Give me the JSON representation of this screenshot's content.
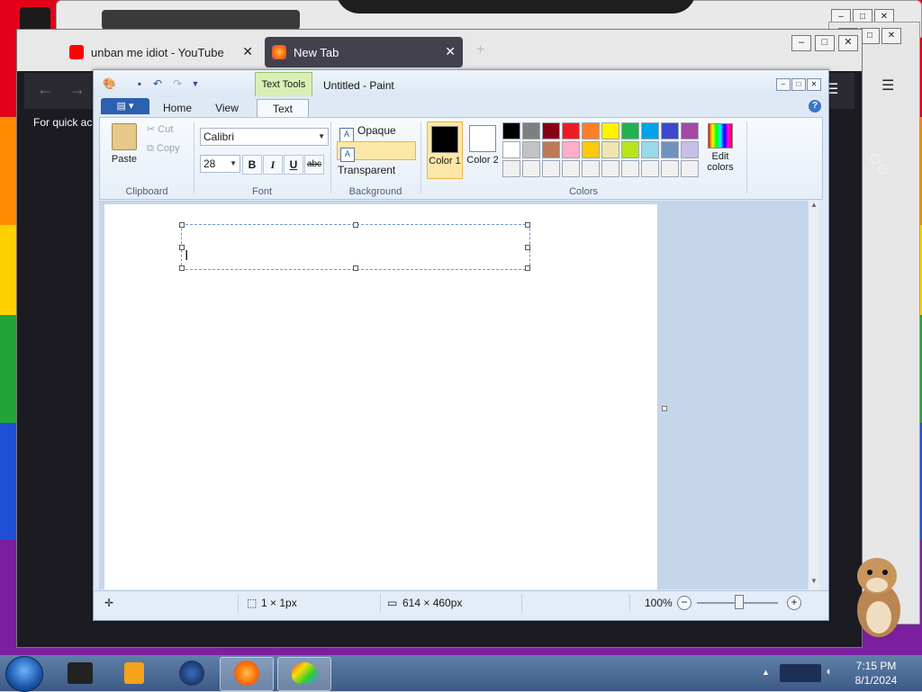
{
  "firefox": {
    "tabs": [
      {
        "title": "unban me idiot - YouTube",
        "active": false
      },
      {
        "title": "New Tab",
        "active": true
      }
    ],
    "new_tab_symbol": "+",
    "quick_access_text": "For quick ac"
  },
  "paint": {
    "title": "Untitled - Paint",
    "context_tab": "Text Tools",
    "tabs": [
      "Home",
      "View",
      "Text"
    ],
    "clipboard": {
      "paste": "Paste",
      "cut": "Cut",
      "copy": "Copy",
      "group": "Clipboard"
    },
    "font": {
      "name": "Calibri",
      "size": "28",
      "bold": "B",
      "italic": "I",
      "underline": "U",
      "strike": "abc",
      "group": "Font"
    },
    "background": {
      "opaque": "Opaque",
      "transparent": "Transparent",
      "group": "Background",
      "selected": "transparent"
    },
    "colors": {
      "color1_label": "Color 1",
      "color2_label": "Color 2",
      "color1": "#000000",
      "color2": "#ffffff",
      "edit_label": "Edit colors",
      "group": "Colors",
      "palette": [
        "#000000",
        "#7f7f7f",
        "#880015",
        "#ed1c24",
        "#ff7f27",
        "#fff200",
        "#22b14c",
        "#00a2e8",
        "#3f48cc",
        "#a349a4",
        "#ffffff",
        "#c3c3c3",
        "#b97a57",
        "#ffaec9",
        "#ffc90e",
        "#efe4b0",
        "#b5e61d",
        "#99d9ea",
        "#7092be",
        "#c8bfe7",
        "#f0f0f0",
        "#f0f0f0",
        "#f0f0f0",
        "#f0f0f0",
        "#f0f0f0",
        "#f0f0f0",
        "#f0f0f0",
        "#f0f0f0",
        "#f0f0f0",
        "#f0f0f0"
      ]
    },
    "status": {
      "selection": "1 × 1px",
      "image_size": "614 × 460px",
      "zoom": "100%"
    }
  },
  "taskbar": {
    "time": "7:15 PM",
    "date": "8/1/2024"
  }
}
